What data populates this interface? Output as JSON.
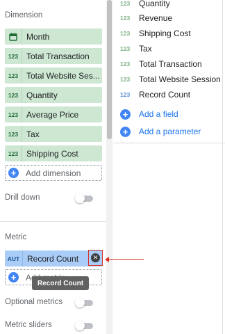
{
  "dimension": {
    "title": "Dimension",
    "items": [
      {
        "type": "calendar",
        "label": "Month"
      },
      {
        "type": "123",
        "label": "Total Transaction"
      },
      {
        "type": "123",
        "label": "Total Website Ses..."
      },
      {
        "type": "123",
        "label": "Quantity"
      },
      {
        "type": "123",
        "label": "Average Price"
      },
      {
        "type": "123",
        "label": "Tax"
      },
      {
        "type": "123",
        "label": "Shipping Cost"
      }
    ],
    "add_label": "Add dimension"
  },
  "drill_down": {
    "label": "Drill down",
    "enabled": false
  },
  "metric": {
    "title": "Metric",
    "item": {
      "type": "AUT",
      "label": "Record Count"
    },
    "add_label": "Add metric",
    "tooltip": "Record Count"
  },
  "optional_metrics": {
    "label": "Optional metrics",
    "enabled": false
  },
  "metric_sliders": {
    "label": "Metric sliders",
    "enabled": false
  },
  "fields": {
    "items": [
      {
        "type": "123",
        "label": "Quantity",
        "color": "green"
      },
      {
        "type": "123",
        "label": "Revenue",
        "color": "green"
      },
      {
        "type": "123",
        "label": "Shipping Cost",
        "color": "green"
      },
      {
        "type": "123",
        "label": "Tax",
        "color": "green"
      },
      {
        "type": "123",
        "label": "Total Transaction",
        "color": "green"
      },
      {
        "type": "123",
        "label": "Total Website Session",
        "color": "green"
      },
      {
        "type": "123",
        "label": "Record Count",
        "color": "blue"
      }
    ],
    "add_field": "Add a field",
    "add_parameter": "Add a parameter"
  },
  "colors": {
    "dimension_chip": "#cde7d2",
    "metric_chip": "#a9cdf7",
    "accent_blue": "#1a73e8",
    "annotation_red": "#d93025"
  }
}
